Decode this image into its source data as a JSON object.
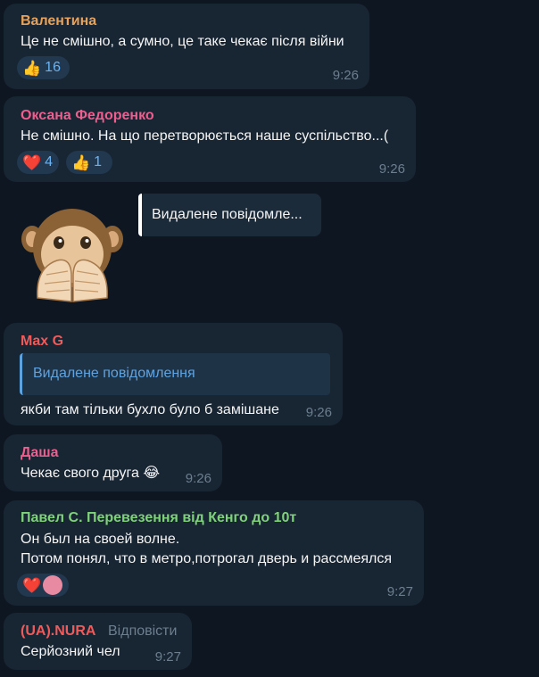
{
  "messages": [
    {
      "sender": "Валентина",
      "text": "Це не смішно, а сумно, це таке чекає після війни",
      "reactions": [
        {
          "emoji": "👍",
          "count": "16"
        }
      ],
      "time": "9:26"
    },
    {
      "sender": "Оксана Федоренко",
      "text": "Не смішно. На що перетворюється наше суспільство...(",
      "reactions": [
        {
          "emoji": "❤️",
          "count": "4"
        },
        {
          "emoji": "👍",
          "count": "1"
        }
      ],
      "time": "9:26"
    },
    {
      "sticker": "monkey-covering-mouth",
      "reply_preview": "Видалене повідомле..."
    },
    {
      "sender": "Max G",
      "reply": "Видалене повідомлення",
      "text": "якби там тільки бухло було б замішане",
      "time": "9:26"
    },
    {
      "sender": "Даша",
      "text": "Чекає свого друга 😂",
      "time": "9:26"
    },
    {
      "sender": "Павел С. Перевезення від Кенго до 10т",
      "text_lines": [
        "Он был на своей волне.",
        "Потом понял, что в метро,потрогал дверь и рассмеялся"
      ],
      "reactions": [
        {
          "emoji": "❤️"
        }
      ],
      "time": "9:27"
    },
    {
      "sender": "(UA).NURA",
      "action": "Відповісти",
      "text": "Серйозний чел",
      "time": "9:27"
    }
  ],
  "colors": {
    "background": "#0e1621",
    "bubble": "#182533",
    "time": "#6d7f8f",
    "sender_1": "#e7a258",
    "sender_2": "#ee5e8e",
    "sender_3": "#ef5b5b",
    "sender_4": "#ee5e8e",
    "sender_5": "#7fd27a",
    "sender_6": "#ef5b5b",
    "accent": "#6ab2f2"
  }
}
